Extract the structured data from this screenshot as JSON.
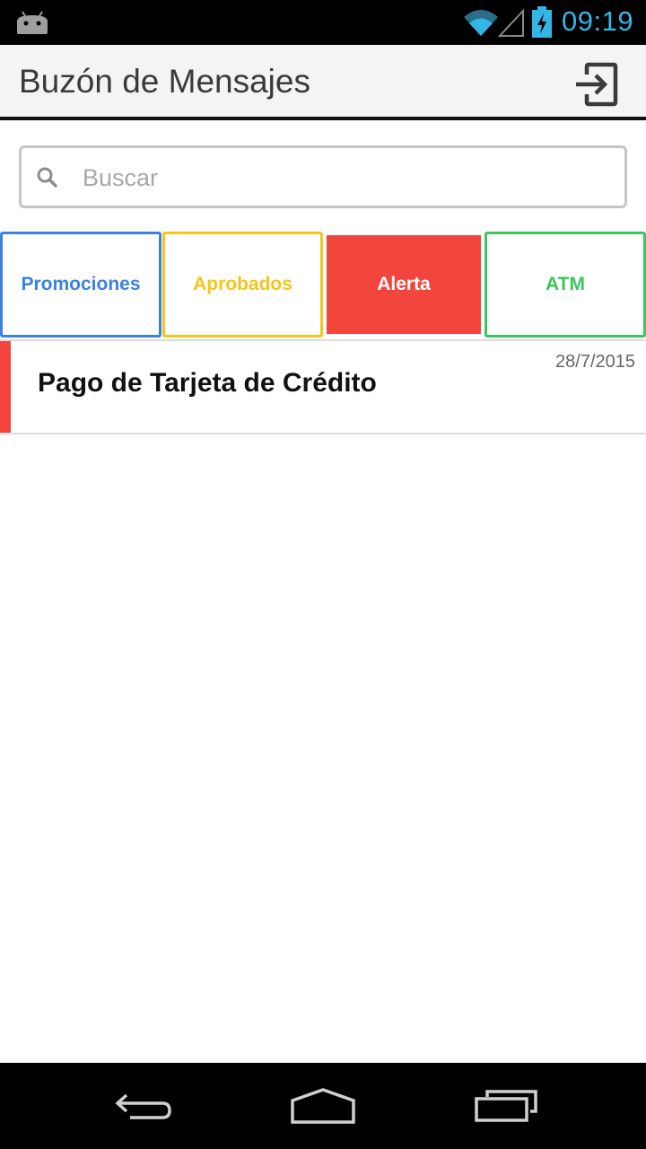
{
  "status_bar": {
    "time": "09:19",
    "colors": {
      "clock": "#33b5e5",
      "background": "#000000"
    },
    "icons": [
      "android-icon",
      "wifi-icon",
      "signal-icon",
      "battery-charging-icon"
    ]
  },
  "app_bar": {
    "title": "Buzón de Mensajes",
    "logout_icon": "logout-icon"
  },
  "search": {
    "placeholder": "Buscar",
    "value": "",
    "icon": "search-icon"
  },
  "tabs": [
    {
      "label": "Promociones",
      "color": "#3b82e0",
      "selected": false
    },
    {
      "label": "Aprobados",
      "color": "#f5c518",
      "selected": false
    },
    {
      "label": "Alerta",
      "color": "#f1453d",
      "selected": true
    },
    {
      "label": "ATM",
      "color": "#3cc55a",
      "selected": false
    }
  ],
  "messages": [
    {
      "subject": "Pago de Tarjeta de Crédito",
      "date": "28/7/2015",
      "category_color": "#f1453d"
    }
  ],
  "nav_bar": {
    "icons": [
      "back-icon",
      "home-icon",
      "recents-icon"
    ]
  }
}
